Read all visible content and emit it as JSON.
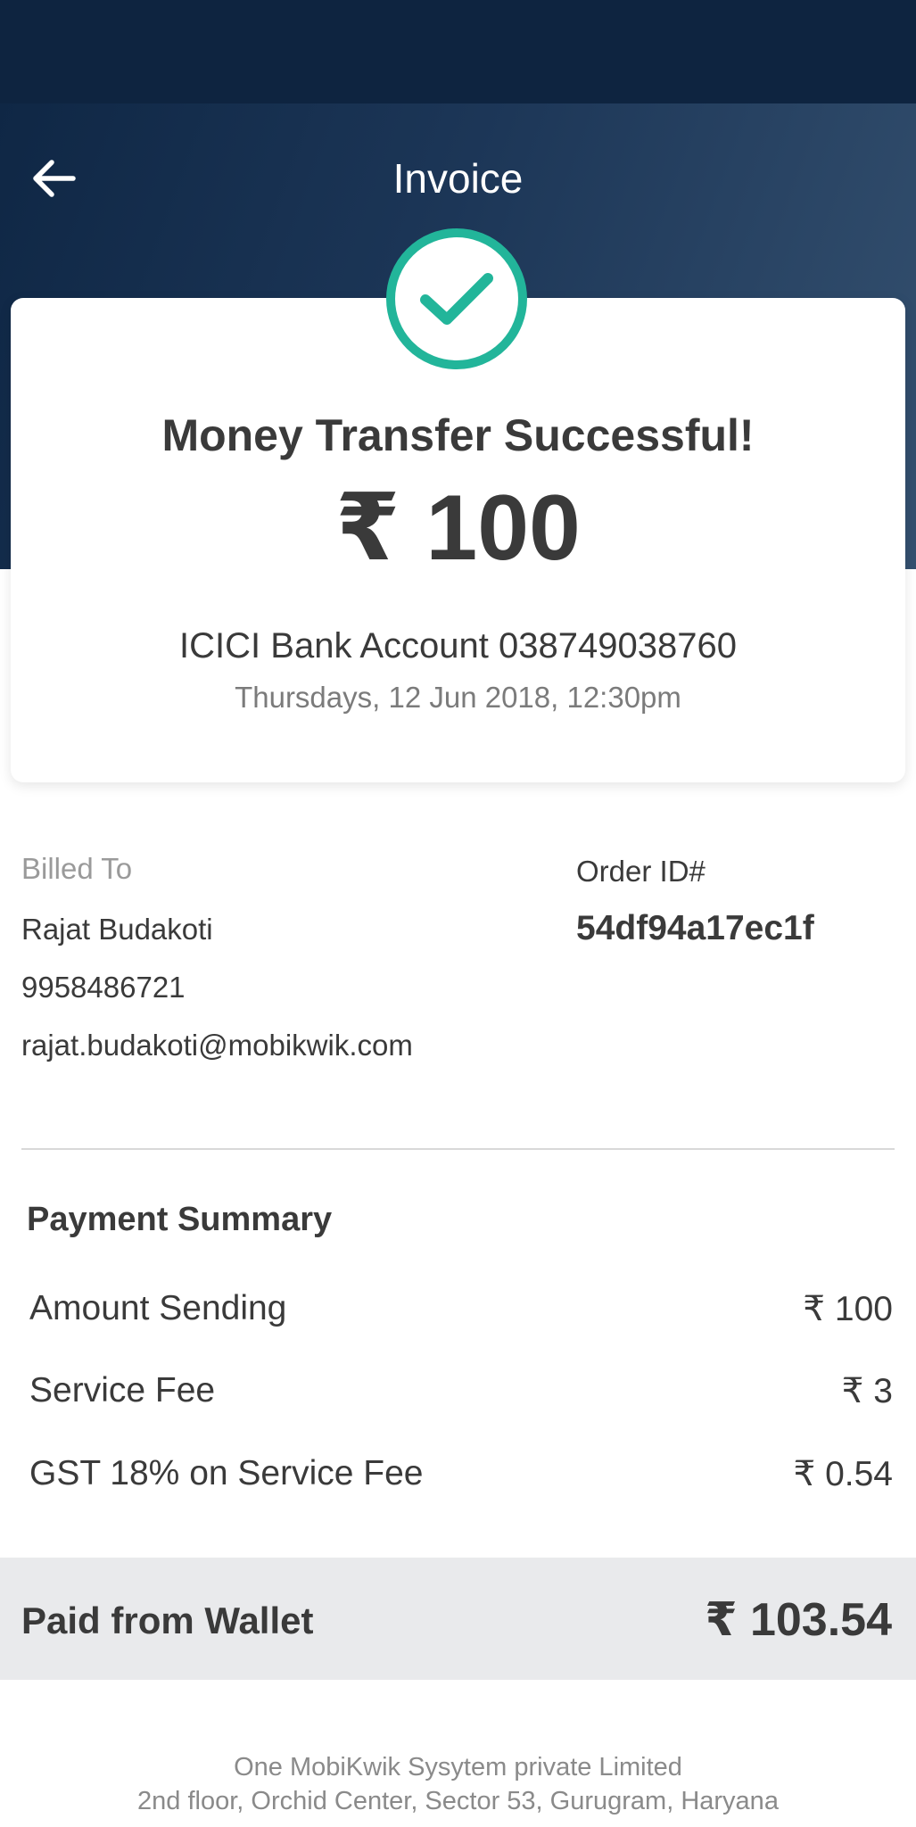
{
  "header": {
    "title": "Invoice",
    "back_icon": "arrow-left-icon"
  },
  "colors": {
    "header_dark": "#0e2440",
    "header_gradient_end": "#34506f",
    "success_green": "#22b59a",
    "paid_bar_bg": "#e9eaec",
    "text_primary": "#3a3a3a",
    "text_muted": "#7b7b7b"
  },
  "status": {
    "icon": "check-circle-icon",
    "title": "Money Transfer Successful!",
    "amount": "₹ 100",
    "account": "ICICI Bank Account 038749038760",
    "date": "Thursdays, 12 Jun 2018, 12:30pm"
  },
  "billing": {
    "label": "Billed To",
    "name": "Rajat Budakoti",
    "phone": "9958486721",
    "email": "rajat.budakoti@mobikwik.com"
  },
  "order": {
    "label": "Order ID#",
    "id": "54df94a17ec1f"
  },
  "summary": {
    "title": "Payment Summary",
    "rows": [
      {
        "label": "Amount Sending",
        "value": "₹ 100"
      },
      {
        "label": "Service Fee",
        "value": "₹ 3"
      },
      {
        "label": "GST 18% on Service Fee",
        "value": "₹ 0.54"
      }
    ]
  },
  "paid": {
    "label": "Paid from Wallet",
    "value": "₹ 103.54"
  },
  "footer": {
    "line1": "One MobiKwik Sysytem private Limited",
    "line2": "2nd floor, Orchid Center, Sector 53, Gurugram, Haryana",
    "line3": ""
  }
}
